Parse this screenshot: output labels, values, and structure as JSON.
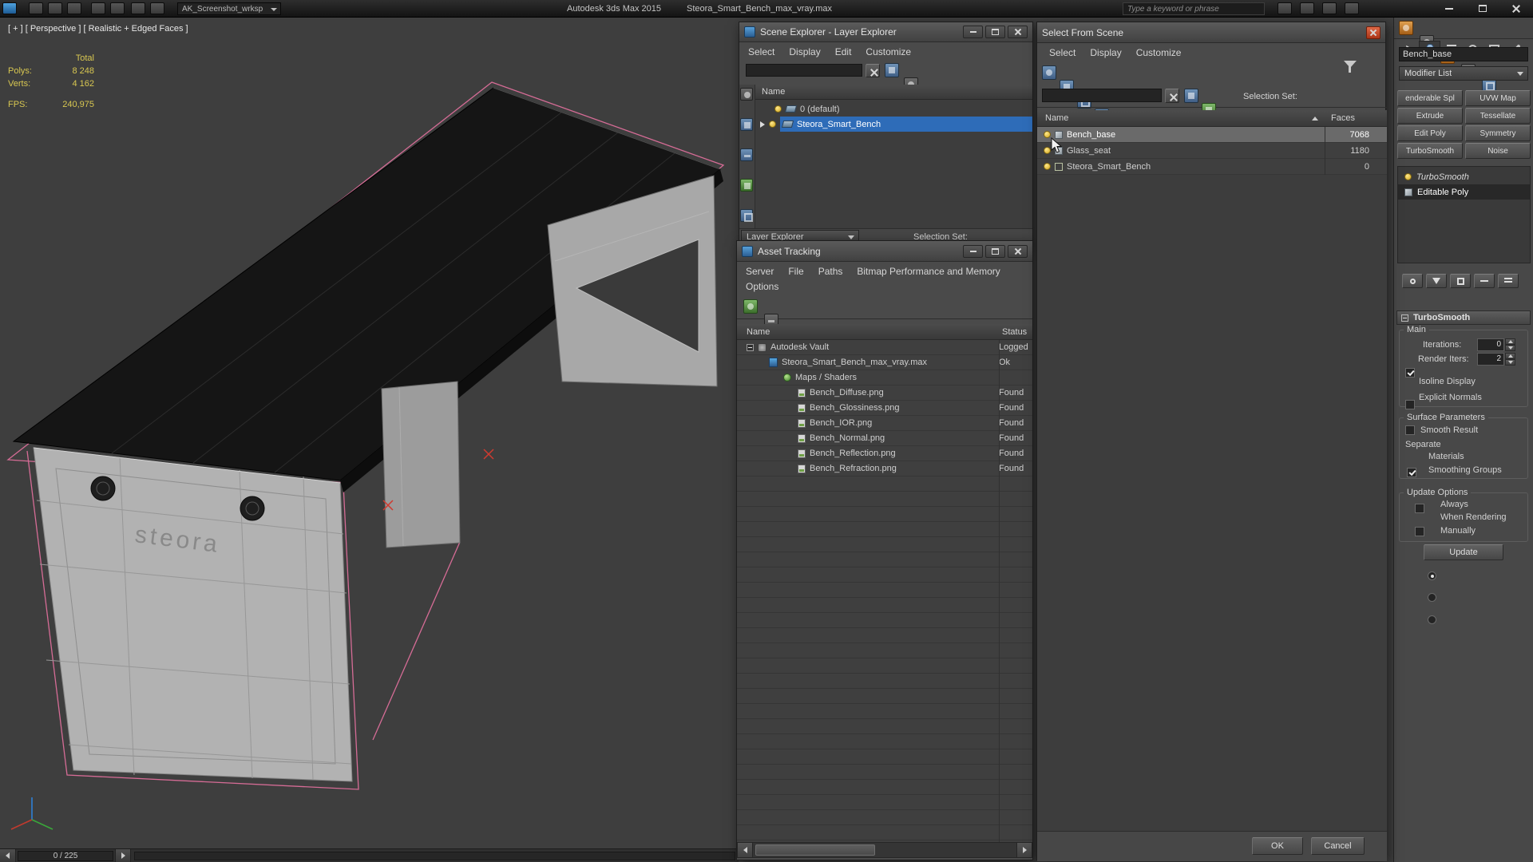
{
  "colors": {
    "selection_blue": "#2e6cb8",
    "row_highlight": "#6a6a6a",
    "stats_yellow": "#d8c751",
    "wire_pink": "#de6f9b",
    "close_red": "#c94f33"
  },
  "titlebar": {
    "workspace": "AK_Screenshot_wrksp",
    "app_title": "Autodesk 3ds Max  2015",
    "file_name": "Steora_Smart_Bench_max_vray.max",
    "search_placeholder": "Type a keyword or phrase"
  },
  "viewport": {
    "header": "[ + ] [ Perspective ] [ Realistic + Edged Faces ]",
    "stats": {
      "total_label": "Total",
      "polys_label": "Polys:",
      "polys_value": "8 248",
      "verts_label": "Verts:",
      "verts_value": "4 162",
      "fps_label": "FPS:",
      "fps_value": "240,975"
    },
    "brand": "steora",
    "timeline_value": "0 / 225"
  },
  "scene_explorer": {
    "title": "Scene Explorer - Layer Explorer",
    "menus": [
      "Select",
      "Display",
      "Edit",
      "Customize"
    ],
    "name_header": "Name",
    "rows": [
      {
        "label": "0 (default)"
      },
      {
        "label": "Steora_Smart_Bench"
      }
    ],
    "footer": {
      "mode": "Layer Explorer",
      "selection_set_label": "Selection Set:"
    }
  },
  "asset_tracking": {
    "title": "Asset Tracking",
    "menus": [
      "Server",
      "File",
      "Paths",
      "Bitmap Performance and Memory",
      "Options"
    ],
    "columns": [
      "Name",
      "Status"
    ],
    "rows": [
      {
        "name": "Autodesk Vault",
        "status": "Logged"
      },
      {
        "name": "Steora_Smart_Bench_max_vray.max",
        "status": "Ok"
      },
      {
        "name": "Maps / Shaders",
        "status": ""
      },
      {
        "name": "Bench_Diffuse.png",
        "status": "Found"
      },
      {
        "name": "Bench_Glossiness.png",
        "status": "Found"
      },
      {
        "name": "Bench_IOR.png",
        "status": "Found"
      },
      {
        "name": "Bench_Normal.png",
        "status": "Found"
      },
      {
        "name": "Bench_Reflection.png",
        "status": "Found"
      },
      {
        "name": "Bench_Refraction.png",
        "status": "Found"
      }
    ]
  },
  "select_from_scene": {
    "title": "Select From Scene",
    "menus": [
      "Select",
      "Display",
      "Customize"
    ],
    "selection_set_label": "Selection Set:",
    "columns": [
      "Name",
      "Faces"
    ],
    "rows": [
      {
        "name": "Bench_base",
        "faces": "7068"
      },
      {
        "name": "Glass_seat",
        "faces": "1180"
      },
      {
        "name": "Steora_Smart_Bench",
        "faces": "0"
      }
    ],
    "ok_label": "OK",
    "cancel_label": "Cancel"
  },
  "command_panel": {
    "object_name": "Bench_base",
    "modifier_list_label": "Modifier List",
    "modifier_buttons": [
      "enderable Spl",
      "UVW Map",
      "Extrude",
      "Tessellate",
      "Edit Poly",
      "Symmetry",
      "TurboSmooth",
      "Noise"
    ],
    "stack": [
      {
        "label": "TurboSmooth"
      },
      {
        "label": "Editable Poly"
      }
    ],
    "rollout_title": "TurboSmooth",
    "rollout": {
      "main_label": "Main",
      "iterations_label": "Iterations:",
      "iterations_value": "0",
      "render_iters_label": "Render Iters:",
      "render_iters_value": "2",
      "isoline_label": "Isoline Display",
      "explicit_label": "Explicit Normals",
      "surface_label": "Surface Parameters",
      "smooth_result_label": "Smooth Result",
      "separate_label": "Separate",
      "materials_label": "Materials",
      "smoothing_label": "Smoothing Groups",
      "update_options_label": "Update Options",
      "always_label": "Always",
      "when_label": "When Rendering",
      "manually_label": "Manually",
      "update_button": "Update"
    }
  }
}
